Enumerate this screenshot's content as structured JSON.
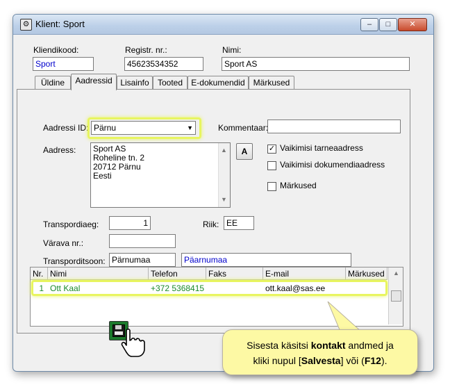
{
  "window": {
    "title": "Klient: Sport",
    "minimize": "–",
    "maximize": "□",
    "close": "✕"
  },
  "header": {
    "kliendikood_label": "Kliendikood:",
    "kliendikood_value": "Sport",
    "registr_label": "Registr. nr.:",
    "registr_value": "45623534352",
    "nimi_label": "Nimi:",
    "nimi_value": "Sport AS"
  },
  "tabs": [
    {
      "label": "Üldine"
    },
    {
      "label": "Aadressid"
    },
    {
      "label": "Lisainfo"
    },
    {
      "label": "Tooted"
    },
    {
      "label": "E-dokumendid"
    },
    {
      "label": "Märkused"
    }
  ],
  "active_tab": "Aadressid",
  "address": {
    "id_label": "Aadressi ID:",
    "id_value": "Pärnu",
    "kommentaar_label": "Kommentaar:",
    "kommentaar_value": "",
    "aadress_label": "Aadress:",
    "lines": [
      "Sport AS",
      "Roheline tn. 2",
      "20712 Pärnu",
      "Eesti"
    ],
    "a_button": "A",
    "cb_tarne": {
      "label": "Vaikimisi tarneaadress",
      "checked": true,
      "mark": "✓"
    },
    "cb_dokument": {
      "label": "Vaikimisi dokumendiaadress",
      "checked": false
    },
    "cb_markused": {
      "label": "Märkused",
      "checked": false
    }
  },
  "transport": {
    "paev_label": "Transpordiaeg:",
    "paev_value": "1",
    "riik_label": "Riik:",
    "riik_value": "EE",
    "varava_label": "Värava nr.:",
    "varava_value": "",
    "tsoon_label": "Transporditsoon:",
    "tsoon_code": "Pärnumaa",
    "tsoon_name": "Päarnumaa"
  },
  "contacts": {
    "columns": [
      "Nr.",
      "Nimi",
      "Telefon",
      "Faks",
      "E-mail",
      "Märkused"
    ],
    "rows": [
      {
        "nr": "1",
        "nimi": "Ott Kaal",
        "telefon": "+372 5368415",
        "faks": "",
        "email": "ott.kaal@sas.ee",
        "markused": ""
      }
    ]
  },
  "callout": {
    "part1": "Sisesta käsitsi ",
    "bold1": "kontakt",
    "part2": " andmed ja",
    "part3": "kliki nupul [",
    "bold2": "Salvesta",
    "part4": "] või (",
    "bold3": "F12",
    "part5": ")."
  },
  "colors": {
    "highlight": "#e8f560",
    "callout_bg": "#fdf9a4",
    "link_blue": "#0000cc",
    "green_text": "#1a8a2a"
  }
}
